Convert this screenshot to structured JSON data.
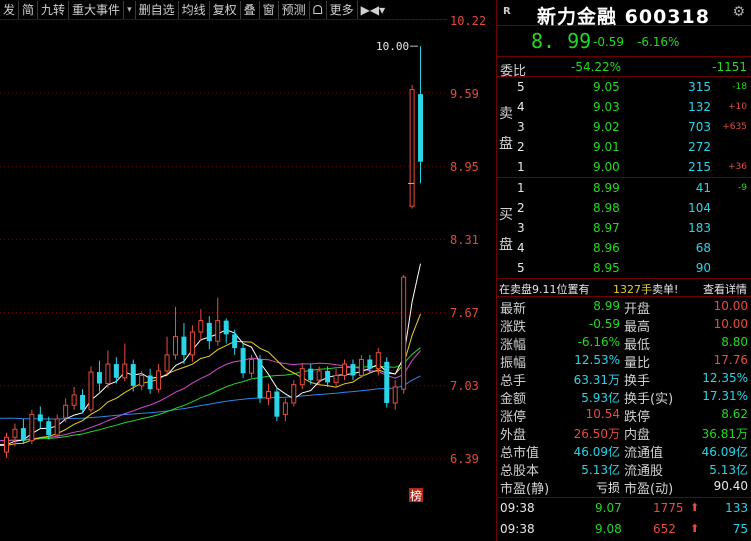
{
  "toolbar": {
    "items": [
      "发",
      "简",
      "九转",
      "重大事件",
      "▾",
      "删自选",
      "均线",
      "复权",
      "叠",
      "窗",
      "预测",
      "ᗝ",
      "更多"
    ],
    "right_arrows": "▶◀▾"
  },
  "chart": {
    "price_labels": [
      "10.22",
      "9.59",
      "8.95",
      "8.31",
      "7.67",
      "7.03",
      "6.39"
    ],
    "limit_label": "10.00",
    "badge": "榜",
    "colors": {
      "up": "#e84c3d",
      "down": "#2ad5e8",
      "ma5": "#ffffff",
      "ma10": "#e8d024",
      "ma20": "#d04ad0",
      "ma30": "#22d922",
      "ma60": "#2a8ae8"
    },
    "candles": [
      {
        "o": 6.45,
        "c": 6.58,
        "h": 6.62,
        "l": 6.4
      },
      {
        "o": 6.58,
        "c": 6.65,
        "h": 6.7,
        "l": 6.5
      },
      {
        "o": 6.66,
        "c": 6.55,
        "h": 6.74,
        "l": 6.52
      },
      {
        "o": 6.55,
        "c": 6.78,
        "h": 6.82,
        "l": 6.52
      },
      {
        "o": 6.78,
        "c": 6.72,
        "h": 6.85,
        "l": 6.66
      },
      {
        "o": 6.72,
        "c": 6.6,
        "h": 6.76,
        "l": 6.56
      },
      {
        "o": 6.6,
        "c": 6.74,
        "h": 6.78,
        "l": 6.57
      },
      {
        "o": 6.75,
        "c": 6.86,
        "h": 6.92,
        "l": 6.71
      },
      {
        "o": 6.86,
        "c": 6.95,
        "h": 7.02,
        "l": 6.82
      },
      {
        "o": 6.95,
        "c": 6.82,
        "h": 7.0,
        "l": 6.79
      },
      {
        "o": 6.82,
        "c": 7.15,
        "h": 7.2,
        "l": 6.8
      },
      {
        "o": 7.15,
        "c": 7.05,
        "h": 7.25,
        "l": 6.98
      },
      {
        "o": 7.05,
        "c": 7.22,
        "h": 7.34,
        "l": 7.01
      },
      {
        "o": 7.22,
        "c": 7.1,
        "h": 7.28,
        "l": 7.05
      },
      {
        "o": 7.1,
        "c": 7.22,
        "h": 7.4,
        "l": 7.07
      },
      {
        "o": 7.22,
        "c": 7.03,
        "h": 7.26,
        "l": 6.98
      },
      {
        "o": 7.03,
        "c": 7.12,
        "h": 7.16,
        "l": 6.99
      },
      {
        "o": 7.12,
        "c": 7.0,
        "h": 7.18,
        "l": 6.96
      },
      {
        "o": 7.0,
        "c": 7.16,
        "h": 7.22,
        "l": 6.97
      },
      {
        "o": 7.16,
        "c": 7.3,
        "h": 7.46,
        "l": 7.12
      },
      {
        "o": 7.3,
        "c": 7.46,
        "h": 7.72,
        "l": 7.26
      },
      {
        "o": 7.46,
        "c": 7.3,
        "h": 7.58,
        "l": 7.22
      },
      {
        "o": 7.3,
        "c": 7.5,
        "h": 7.56,
        "l": 7.24
      },
      {
        "o": 7.5,
        "c": 7.6,
        "h": 7.7,
        "l": 7.42
      },
      {
        "o": 7.58,
        "c": 7.42,
        "h": 7.64,
        "l": 7.35
      },
      {
        "o": 7.42,
        "c": 7.6,
        "h": 7.8,
        "l": 7.38
      },
      {
        "o": 7.6,
        "c": 7.48,
        "h": 7.62,
        "l": 7.4
      },
      {
        "o": 7.48,
        "c": 7.36,
        "h": 7.52,
        "l": 7.3
      },
      {
        "o": 7.36,
        "c": 7.14,
        "h": 7.4,
        "l": 7.1
      },
      {
        "o": 7.14,
        "c": 7.26,
        "h": 7.3,
        "l": 7.1
      },
      {
        "o": 7.26,
        "c": 6.92,
        "h": 7.3,
        "l": 6.88
      },
      {
        "o": 6.92,
        "c": 6.98,
        "h": 7.05,
        "l": 6.86
      },
      {
        "o": 6.98,
        "c": 6.76,
        "h": 7.02,
        "l": 6.72
      },
      {
        "o": 6.78,
        "c": 6.88,
        "h": 6.92,
        "l": 6.72
      },
      {
        "o": 6.88,
        "c": 7.04,
        "h": 7.08,
        "l": 6.85
      },
      {
        "o": 7.04,
        "c": 7.18,
        "h": 7.22,
        "l": 7.0
      },
      {
        "o": 7.18,
        "c": 7.08,
        "h": 7.22,
        "l": 7.04
      },
      {
        "o": 7.08,
        "c": 7.16,
        "h": 7.2,
        "l": 7.04
      },
      {
        "o": 7.16,
        "c": 7.06,
        "h": 7.2,
        "l": 7.02
      },
      {
        "o": 7.06,
        "c": 7.12,
        "h": 7.18,
        "l": 7.03
      },
      {
        "o": 7.12,
        "c": 7.22,
        "h": 7.26,
        "l": 7.08
      },
      {
        "o": 7.22,
        "c": 7.12,
        "h": 7.26,
        "l": 7.08
      },
      {
        "o": 7.12,
        "c": 7.26,
        "h": 7.3,
        "l": 7.1
      },
      {
        "o": 7.26,
        "c": 7.18,
        "h": 7.3,
        "l": 7.14
      },
      {
        "o": 7.18,
        "c": 7.32,
        "h": 7.36,
        "l": 7.12
      },
      {
        "o": 7.24,
        "c": 6.88,
        "h": 7.28,
        "l": 6.84
      },
      {
        "o": 6.88,
        "c": 7.02,
        "h": 7.08,
        "l": 6.82
      },
      {
        "o": 7.0,
        "c": 7.98,
        "h": 8.0,
        "l": 6.96
      },
      {
        "o": 8.6,
        "c": 9.62,
        "h": 9.66,
        "l": 8.58
      },
      {
        "o": 9.58,
        "c": 8.99,
        "h": 10.0,
        "l": 8.8
      }
    ]
  },
  "panel": {
    "market_tag": "R",
    "name": "新力金融",
    "code": "600318",
    "price": "8. 99",
    "change": "-0.59",
    "change_pct": "-6.16%",
    "weibi_label": "委比",
    "weibi_pct": "-54.22%",
    "weicha": "-1151",
    "sell_label_1": "卖",
    "sell_label_2": "盘",
    "buy_label_1": "买",
    "buy_label_2": "盘",
    "asks": [
      {
        "lv": "5",
        "p": "9.05",
        "v": "315",
        "d": "-18"
      },
      {
        "lv": "4",
        "p": "9.03",
        "v": "132",
        "d": "+10"
      },
      {
        "lv": "3",
        "p": "9.02",
        "v": "703",
        "d": "+635"
      },
      {
        "lv": "2",
        "p": "9.01",
        "v": "272",
        "d": ""
      },
      {
        "lv": "1",
        "p": "9.00",
        "v": "215",
        "d": "+36"
      }
    ],
    "bids": [
      {
        "lv": "1",
        "p": "8.99",
        "v": "41",
        "d": "-9"
      },
      {
        "lv": "2",
        "p": "8.98",
        "v": "104",
        "d": ""
      },
      {
        "lv": "3",
        "p": "8.97",
        "v": "183",
        "d": ""
      },
      {
        "lv": "4",
        "p": "8.96",
        "v": "68",
        "d": ""
      },
      {
        "lv": "5",
        "p": "8.95",
        "v": "90",
        "d": ""
      }
    ],
    "vinfo": {
      "text": "在卖盘9.11位置有",
      "hands": "1327手",
      "action": "卖单!",
      "link": "查看详情"
    },
    "stats": [
      {
        "l1": "最新",
        "v1": "8.99",
        "c1": "grn",
        "l2": "开盘",
        "v2": "10.00",
        "c2": "red"
      },
      {
        "l1": "涨跌",
        "v1": "-0.59",
        "c1": "grn",
        "l2": "最高",
        "v2": "10.00",
        "c2": "red"
      },
      {
        "l1": "涨幅",
        "v1": "-6.16%",
        "c1": "grn",
        "l2": "最低",
        "v2": "8.80",
        "c2": "grn"
      },
      {
        "l1": "振幅",
        "v1": "12.53%",
        "c1": "cy",
        "l2": "量比",
        "v2": "17.76",
        "c2": "red"
      },
      {
        "l1": "总手",
        "v1": "63.31万",
        "c1": "cy",
        "l2": "换手",
        "v2": "12.35%",
        "c2": "cy"
      },
      {
        "l1": "金额",
        "v1": "5.93亿",
        "c1": "cy",
        "l2": "换手(实)",
        "v2": "17.31%",
        "c2": "cy"
      },
      {
        "l1": "涨停",
        "v1": "10.54",
        "c1": "red",
        "l2": "跌停",
        "v2": "8.62",
        "c2": "grn"
      },
      {
        "l1": "外盘",
        "v1": "26.50万",
        "c1": "red",
        "l2": "内盘",
        "v2": "36.81万",
        "c2": "grn"
      },
      {
        "l1": "总市值",
        "v1": "46.09亿",
        "c1": "cy",
        "l2": "流通值",
        "v2": "46.09亿",
        "c2": "cy"
      },
      {
        "l1": "总股本",
        "v1": "5.13亿",
        "c1": "cy",
        "l2": "流通股",
        "v2": "5.13亿",
        "c2": "cy"
      },
      {
        "l1": "市盈(静)",
        "v1": "亏损",
        "c1": "wht",
        "l2": "市盈(动)",
        "v2": "90.40",
        "c2": "wht"
      }
    ],
    "ticks": [
      {
        "t": "09:38",
        "p": "9.07",
        "v": "1775",
        "n": "133"
      },
      {
        "t": "09:38",
        "p": "9.08",
        "v": "652",
        "n": "75"
      }
    ]
  }
}
